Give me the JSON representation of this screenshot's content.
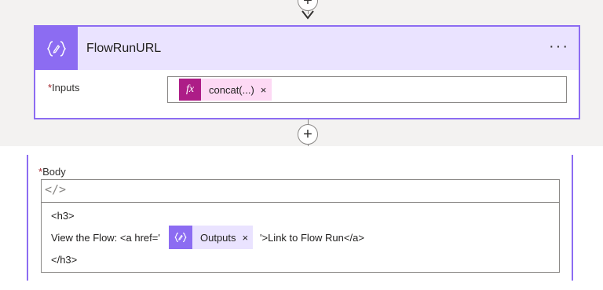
{
  "top_connector": {
    "plus_label": "+"
  },
  "card": {
    "title": "FlowRunURL",
    "more_label": "···",
    "inputs": {
      "required_mark": "*",
      "label": "Inputs",
      "token_label": "concat(...)",
      "token_icon_text": "fx",
      "token_remove": "×"
    },
    "accent_color": "#8c6cf2",
    "header_bg": "#eae3ff",
    "fx_color": "#ad1d87"
  },
  "bottom_connector": {
    "plus_label": "+"
  },
  "body_field": {
    "required_mark": "*",
    "label": "Body",
    "code_toggle": "</>",
    "lines": {
      "open_tag": "<h3>",
      "link_prefix": "View the Flow: <a href='",
      "link_suffix": "'>Link to Flow Run</a>",
      "close_tag": "</h3>"
    },
    "token_label": "Outputs",
    "token_remove": "×"
  }
}
